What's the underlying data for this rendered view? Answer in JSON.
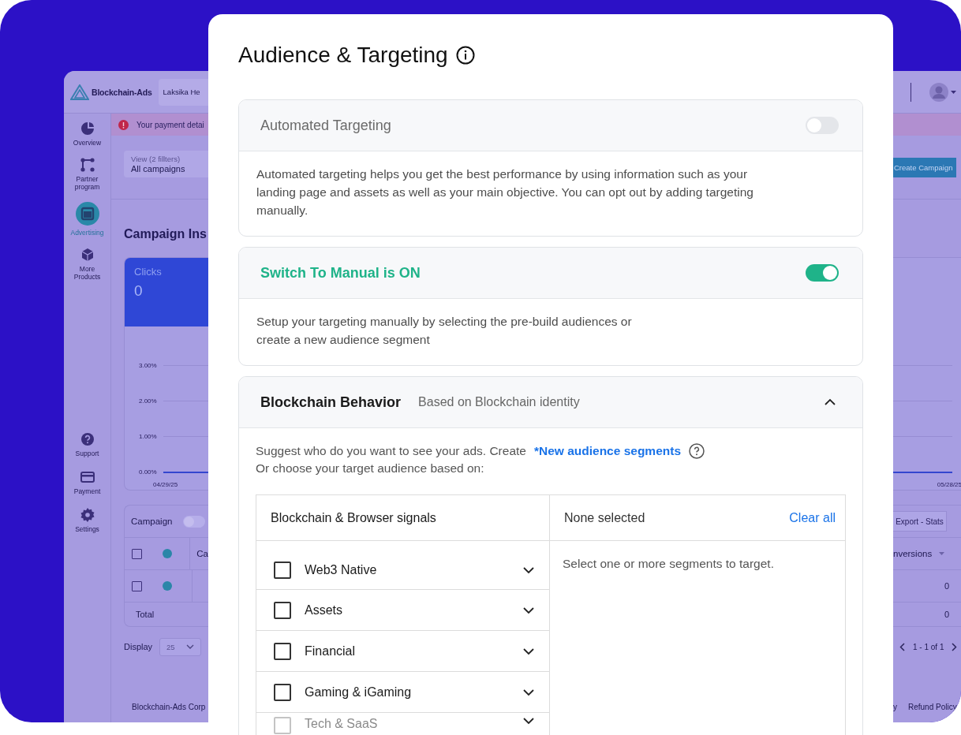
{
  "background_app": {
    "brand": "Blockchain-Ads",
    "account": "Laksika He",
    "sidebar": {
      "main": [
        {
          "label": "Overview",
          "selected": false
        },
        {
          "label": "Partner program",
          "selected": false
        },
        {
          "label": "Advertising",
          "selected": true
        },
        {
          "label": "More Products",
          "selected": false
        }
      ],
      "footer": [
        {
          "label": "Support",
          "selected": false
        },
        {
          "label": "Payment",
          "selected": false
        },
        {
          "label": "Settings",
          "selected": false
        }
      ]
    },
    "alert": "Your payment detai",
    "view_filter": {
      "label": "View (2 fillters)",
      "value": "All campaigns"
    },
    "create_button": "Create Campaign",
    "heading": "Campaign Ins",
    "metric": {
      "label": "Clicks",
      "value": "0"
    },
    "chart_axis_labels": [
      "3.00%",
      "2.00%",
      "1.00%",
      "0.00%"
    ],
    "chart_dates": [
      "04/29/25",
      "05/28/25"
    ],
    "campaign_table": {
      "title": "Campaign",
      "toggle_on": false,
      "export_button": "Export - Stats",
      "header": {
        "checked": false,
        "color": "#2b86a8",
        "column_left": "Ca",
        "column_right": "nversions"
      },
      "rows": [
        {
          "checked": false,
          "color": "#2b86a8",
          "value": "0"
        }
      ],
      "total": {
        "label": "Total",
        "value": "0"
      }
    },
    "display": {
      "label": "Display",
      "value": "25"
    },
    "pagination": "1 - 1 of 1",
    "footer_left": "Blockchain-Ads Corp",
    "footer_right": [
      "y",
      "Refund Policy"
    ]
  },
  "dialog": {
    "title": "Audience & Targeting",
    "sections": [
      {
        "kind": "toggle",
        "title": "Automated Targeting",
        "on": false,
        "description": "Automated targeting helps you get the best performance by using information such as your\nlanding page and assets as well as your main objective. You can opt out by adding targeting\nmanually."
      },
      {
        "kind": "toggle",
        "title": "Switch To Manual is ON",
        "on": true,
        "description": "Setup your targeting manually by selecting the pre-build audiences or\ncreate a new audience segment"
      },
      {
        "kind": "accordion",
        "title": "Blockchain Behavior",
        "subtitle": "Based on Blockchain identity",
        "expanded": true,
        "prompt": "Suggest who do you want to see your ads. Create",
        "link": "*New audience segments",
        "prompt_2": "Or choose your target audience based on:",
        "picker": {
          "heading": "Blockchain & Browser signals",
          "options": [
            {
              "label": "Web3 Native",
              "checked": false,
              "expanded": false
            },
            {
              "label": "Assets",
              "checked": false,
              "expanded": false
            },
            {
              "label": "Financial",
              "checked": false,
              "expanded": false
            },
            {
              "label": "Gaming & iGaming",
              "checked": false,
              "expanded": false
            },
            {
              "label": "Tech & SaaS",
              "checked": false,
              "expanded": false
            }
          ],
          "selection_heading": "None selected",
          "clear_button": "Clear all",
          "empty_text": "Select one or more segments to target."
        }
      }
    ]
  }
}
